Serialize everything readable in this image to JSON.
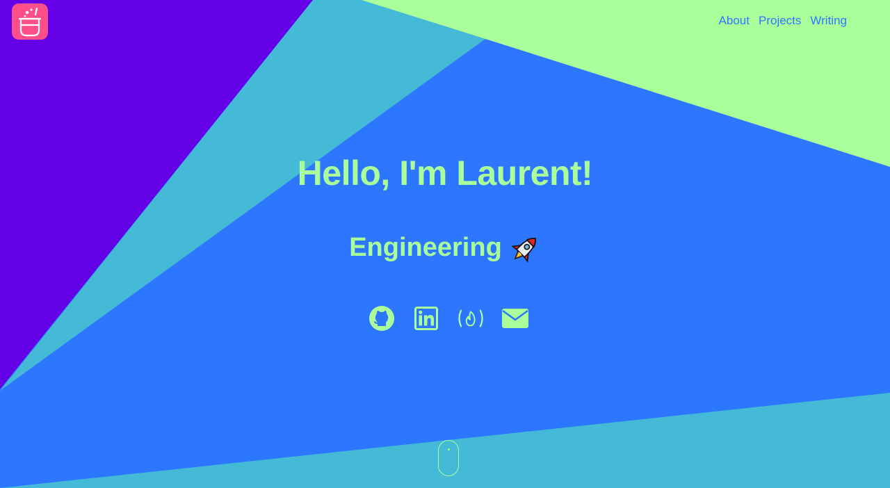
{
  "colors": {
    "background_main": "#2d76ff",
    "purple_panel": "#6300e6",
    "cyan_panel": "#45bad6",
    "green_panel": "#aaff9a",
    "logo_bg": "#ff4f8b",
    "accent_text": "#aaff9a",
    "nav_link": "#2d76ff"
  },
  "nav": {
    "about": "About",
    "projects": "Projects",
    "writing": "Writing"
  },
  "hero": {
    "title": "Hello, I'm Laurent!",
    "subtitle": "Engineering"
  },
  "socials": {
    "github": "github-icon",
    "linkedin": "linkedin-icon",
    "freecodecamp": "freecodecamp-icon",
    "email": "mail-icon"
  },
  "icons": {
    "logo": "cauldron-logo-icon",
    "rocket": "rocket-icon",
    "scroll": "scroll-mouse-icon"
  }
}
